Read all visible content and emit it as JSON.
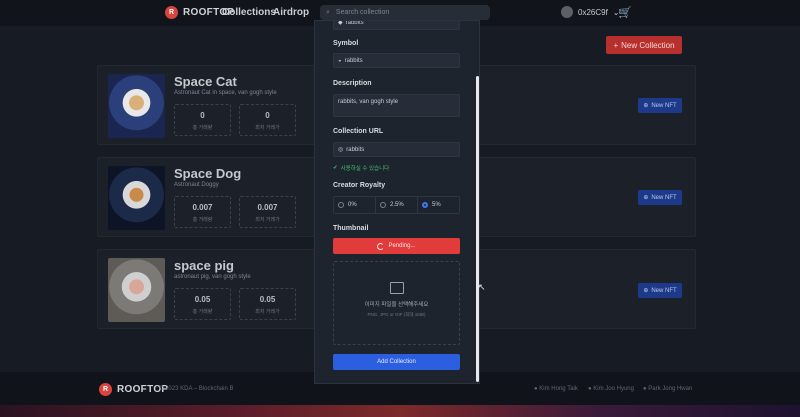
{
  "navbar": {
    "brand": "ROOFTOP",
    "links": [
      "Collections",
      "Airdrop"
    ],
    "search_placeholder": "Search collection",
    "wallet": "0x26C9f",
    "new_collection_label": "New Collection"
  },
  "collections": [
    {
      "name": "Space Cat",
      "desc": "Astronaut Cat in space, van gogh style",
      "stat1_val": "0",
      "stat1_lbl": "총 거래량",
      "stat2_val": "0",
      "stat2_lbl": "최저 거래가"
    },
    {
      "name": "Space Dog",
      "desc": "Astronaut Doggy",
      "stat1_val": "0.007",
      "stat1_lbl": "총 거래량",
      "stat2_val": "0.007",
      "stat2_lbl": "최저 거래가"
    },
    {
      "name": "space pig",
      "desc": "astronaut pig, van gogh style",
      "stat1_val": "0.05",
      "stat1_lbl": "총 거래량",
      "stat2_val": "0.05",
      "stat2_lbl": "최저 거래가"
    }
  ],
  "new_nft_label": "New NFT",
  "modal": {
    "top_value": "rabbits",
    "symbol_label": "Symbol",
    "symbol_value": "rabbits",
    "description_label": "Description",
    "description_value": "rabbits, van gogh style",
    "url_label": "Collection URL",
    "url_value": "rabbits",
    "url_hint": "사용하실 수 있습니다",
    "royalty_label": "Creator Royalty",
    "royalty_options": [
      "0%",
      "2.5%",
      "5%"
    ],
    "royalty_selected": "5%",
    "thumbnail_label": "Thumbnail",
    "pending_label": "Pending...",
    "dropzone_text": "이미지 파일을 선택해주세요",
    "dropzone_sub": "PNG, JPG or GIF (최대 1MB)",
    "submit_label": "Add Collection"
  },
  "footer": {
    "brand": "ROOFTOP",
    "copy": "© 2023 KDA – Blockchain B",
    "devs": [
      "Kim Hong Taik",
      "Kim Joo Hyung",
      "Park Jong Hwan"
    ]
  },
  "colors": {
    "accent_red": "#e23b3b",
    "accent_blue": "#2b5fe0",
    "success_green": "#3fbf6a"
  }
}
